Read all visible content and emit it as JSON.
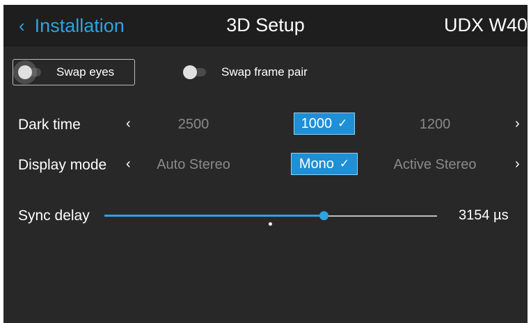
{
  "header": {
    "back_chevron": "‹",
    "back_label": "Installation",
    "title": "3D Setup",
    "model": "UDX W40"
  },
  "toggles": [
    {
      "label": "Swap eyes",
      "on": false,
      "focused": true
    },
    {
      "label": "Swap frame pair",
      "on": false,
      "focused": false
    }
  ],
  "dark_time": {
    "label": "Dark time",
    "prev": "‹",
    "next": "›",
    "options": [
      "2500",
      "1000",
      "1200"
    ],
    "selected": "1000",
    "check": "✓"
  },
  "display_mode": {
    "label": "Display mode",
    "prev": "‹",
    "next": "›",
    "options": [
      "Auto Stereo",
      "Mono",
      "Active Stereo"
    ],
    "selected": "Mono",
    "check": "✓"
  },
  "sync_delay": {
    "label": "Sync delay",
    "value": "3154 µs",
    "fraction": 0.66
  },
  "colors": {
    "accent": "#2ea3e0",
    "background": "#282828",
    "header": "#1e1e1e",
    "selected_bg": "#1f8fd6"
  }
}
